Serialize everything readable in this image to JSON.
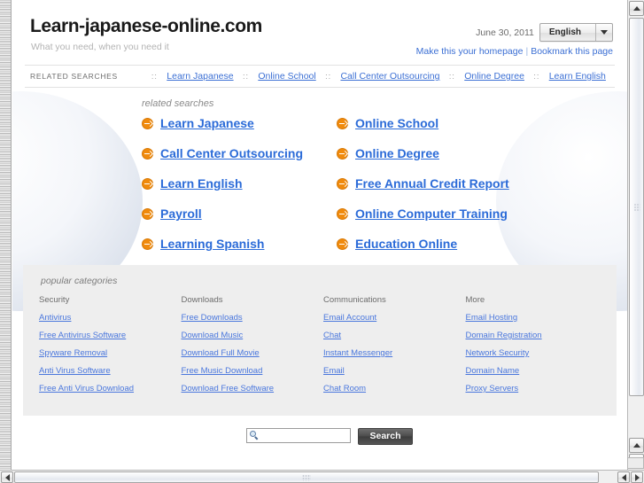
{
  "header": {
    "site_title": "Learn-japanese-online.com",
    "tagline": "What you need, when you need it",
    "date": "June 30, 2011",
    "language": "English",
    "homepage_link": "Make this your homepage",
    "bookmark_link": "Bookmark this page",
    "separator": "|"
  },
  "related_strip": {
    "label": "RELATED SEARCHES",
    "dots": "::",
    "links": [
      "Learn Japanese",
      "Online School",
      "Call Center Outsourcing",
      "Online Degree",
      "Learn English"
    ]
  },
  "main": {
    "heading": "related searches",
    "links": [
      "Learn Japanese",
      "Online School",
      "Call Center Outsourcing",
      "Online Degree",
      "Learn English",
      "Free Annual Credit Report",
      "Payroll",
      "Online Computer Training",
      "Learning Spanish",
      "Education Online"
    ]
  },
  "categories": {
    "heading": "popular categories",
    "columns": [
      {
        "title": "Security",
        "links": [
          "Antivirus",
          "Free Antivirus Software",
          "Spyware Removal",
          "Anti Virus Software",
          "Free Anti Virus Download"
        ]
      },
      {
        "title": "Downloads",
        "links": [
          "Free Downloads",
          "Download Music",
          "Download Full Movie",
          "Free Music Download",
          "Download Free Software"
        ]
      },
      {
        "title": "Communications",
        "links": [
          "Email Account",
          "Chat",
          "Instant Messenger",
          "Email",
          "Chat Room"
        ]
      },
      {
        "title": "More",
        "links": [
          "Email Hosting",
          "Domain Registration",
          "Network Security",
          "Domain Name",
          "Proxy Servers"
        ]
      }
    ]
  },
  "search": {
    "value": "",
    "placeholder": "",
    "button_label": "Search"
  },
  "colors": {
    "link_blue": "#3b6fd4",
    "big_link_blue": "#2b6bd8",
    "category_link_blue": "#4a77dd",
    "bullet_orange": "#f08a0c",
    "panel_gray": "#eeeeee",
    "muted_text": "#8a8a8a"
  }
}
